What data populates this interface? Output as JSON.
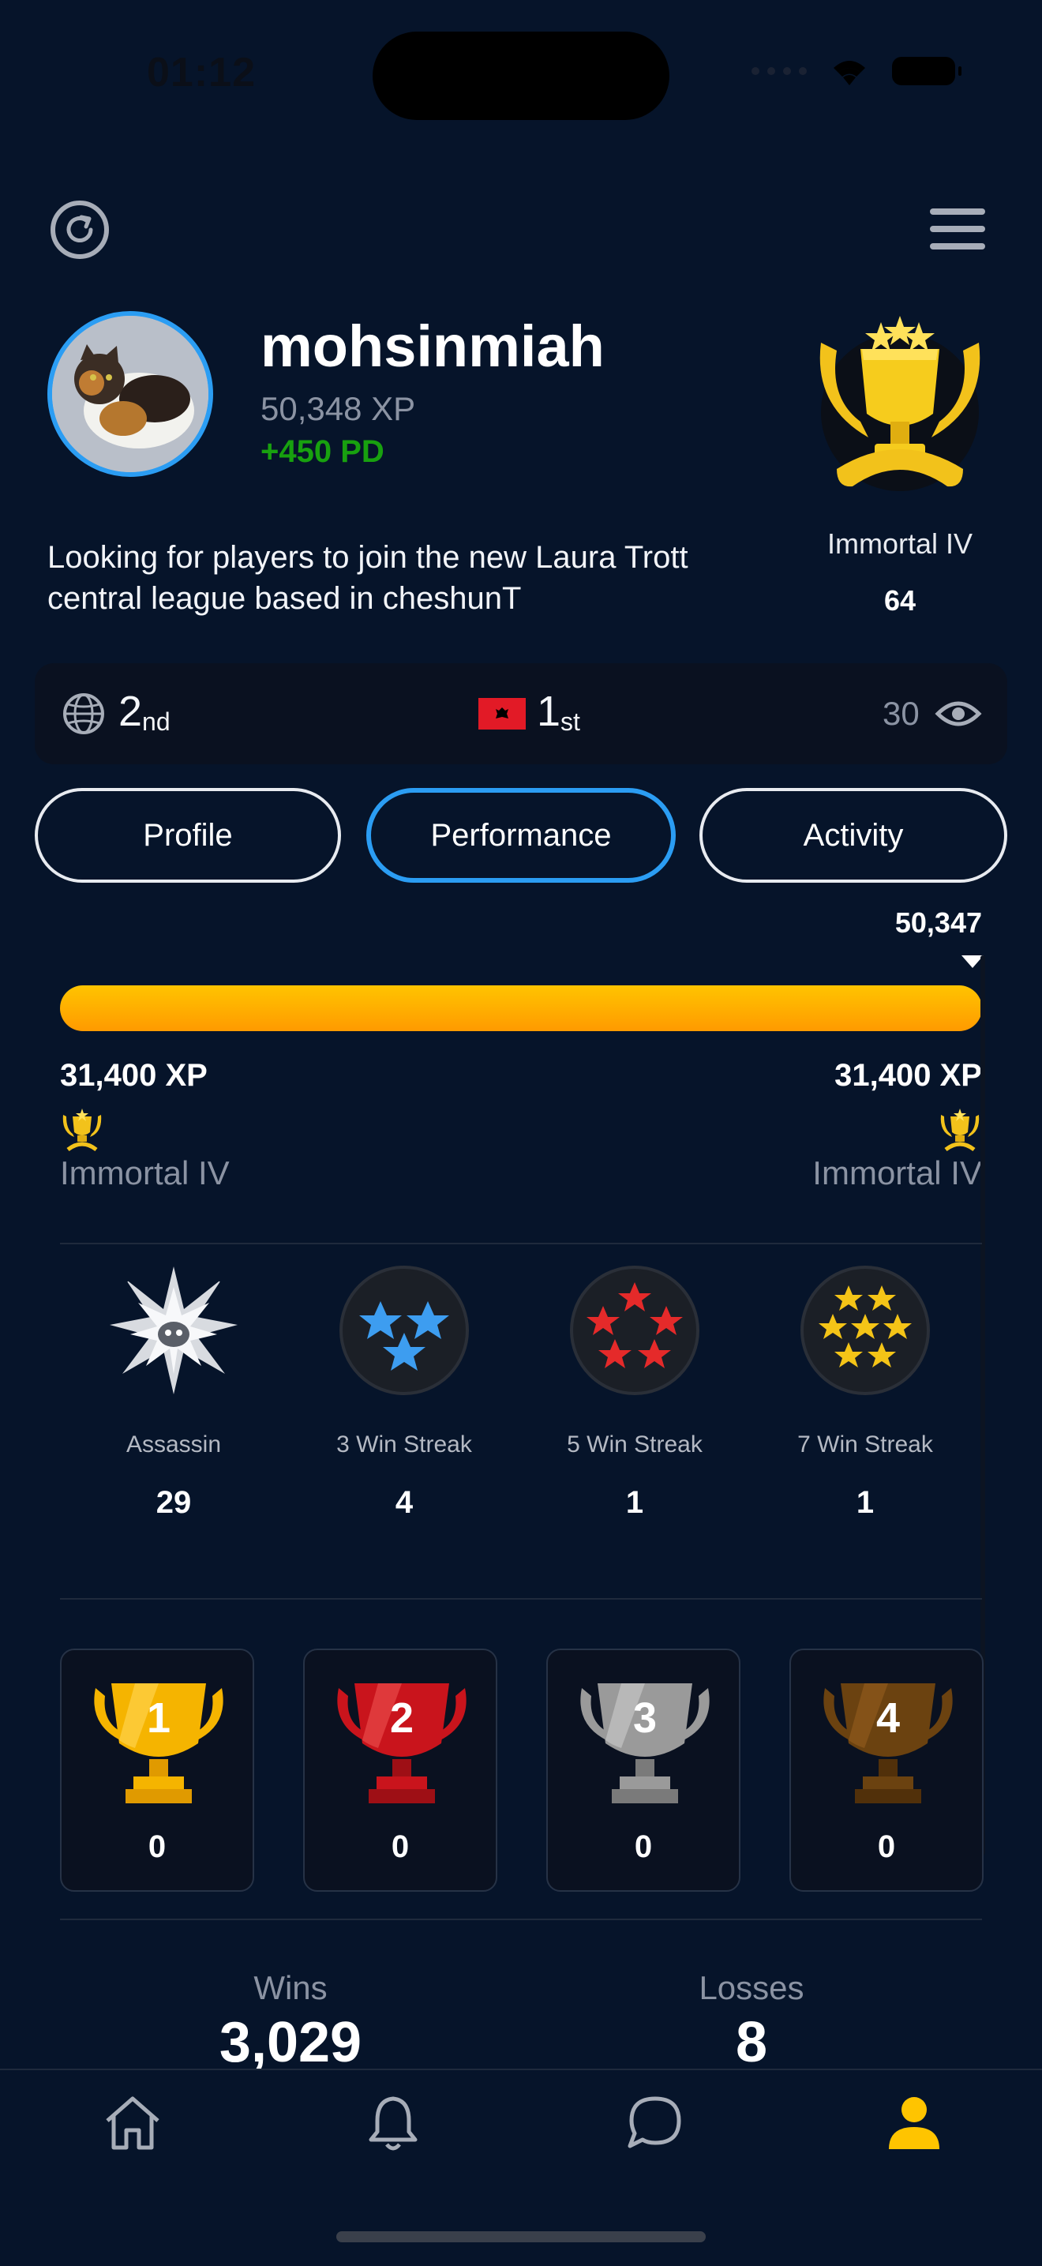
{
  "status": {
    "time": "01:12"
  },
  "profile": {
    "username": "mohsinmiah",
    "xp": "50,348 XP",
    "pd": "+450 PD",
    "bio": "Looking for players to join the new Laura Trott central league based in cheshunT",
    "rank_name": "Immortal IV",
    "rank_number": "64"
  },
  "stats": {
    "global_rank": "2",
    "global_suffix": "nd",
    "country_rank": "1",
    "country_suffix": "st",
    "views": "30"
  },
  "tabs": [
    {
      "label": "Profile",
      "active": false
    },
    {
      "label": "Performance",
      "active": true
    },
    {
      "label": "Activity",
      "active": false
    }
  ],
  "progress": {
    "current": "50,347",
    "fill_fraction": 1.0,
    "left_xp": "31,400 XP",
    "right_xp": "31,400 XP",
    "left_tier": "Immortal IV",
    "right_tier": "Immortal IV"
  },
  "achievements": [
    {
      "label": "Assassin",
      "count": "29",
      "icon": "assassin-star-icon"
    },
    {
      "label": "3 Win Streak",
      "count": "4",
      "icon": "blue-stars-icon"
    },
    {
      "label": "5 Win Streak",
      "count": "1",
      "icon": "red-stars-icon"
    },
    {
      "label": "7 Win Streak",
      "count": "1",
      "icon": "gold-stars-icon"
    }
  ],
  "trophies": [
    {
      "place": "1",
      "count": "0",
      "color": "#f5b400"
    },
    {
      "place": "2",
      "count": "0",
      "color": "#c9141c"
    },
    {
      "place": "3",
      "count": "0",
      "color": "#9a9a9a"
    },
    {
      "place": "4",
      "count": "0",
      "color": "#6b4210"
    }
  ],
  "record": {
    "wins_label": "Wins",
    "wins": "3,029",
    "losses_label": "Losses",
    "losses": "8"
  },
  "nav": [
    "home-icon",
    "bell-icon",
    "chat-icon",
    "profile-icon"
  ],
  "colors": {
    "accent": "#2b9df3",
    "gold": "#ffc400",
    "pd_green": "#18a10f",
    "background": "#06142a"
  }
}
